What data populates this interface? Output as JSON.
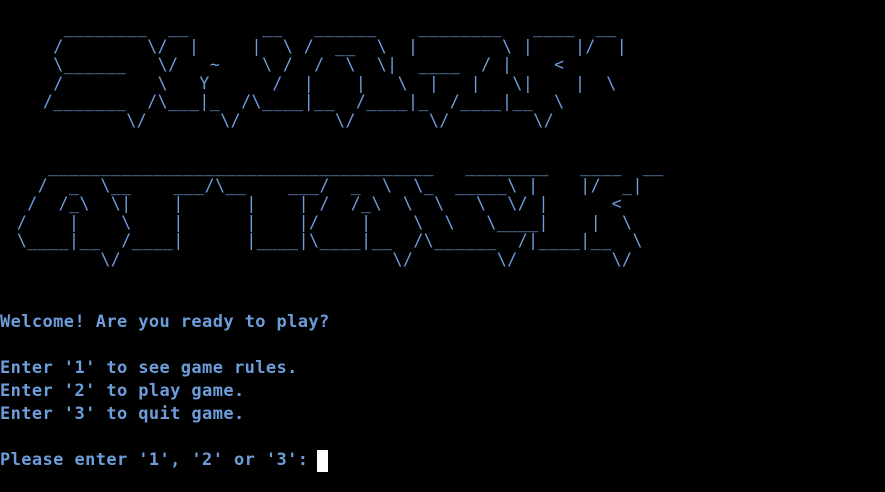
{
  "terminal": {
    "title_art_shark": "    ________  __       __   ______    ________   ____  __\n   /        \\/  |     |  \\ /  __  \\  |        \\ |    |/  |\n   \\______   \\/   ~    \\ /  /  \\  \\|  ____  / |    <\n   /         \\   Y      /  |    |   \\  |   |   \\|    |  \\\n  /_______  /\\___|_  /\\____|__  /____|_  /____|__  \\\n          \\/       \\/         \\/       \\/        \\/",
    "title_art_attack": "     _____________________________________   ________   ____  __\n    /  _  \\__    ___/\\__    ___/  _  \\  \\_  _____\\ |    |/  _|\n   /  /_\\  \\|    |      |    | /  /_\\  \\  \\   \\  \\/ |      <\n  /    |    \\    |      |    |/    |    \\  \\   \\____|    |  \\\n  \\____|__  /____|      |____|\\____|__  /\\______  /|____|__  \\\n          \\/                          \\/        \\/         \\/",
    "welcome": "Welcome! Are you ready to play?",
    "options": [
      "Enter '1' to see game rules.",
      "Enter '2' to play game.",
      "Enter '3' to quit game."
    ],
    "prompt": "Please enter '1', '2' or '3':",
    "colors": {
      "background": "#000000",
      "text": "#6d9edb",
      "cursor": "#ffffff"
    }
  }
}
